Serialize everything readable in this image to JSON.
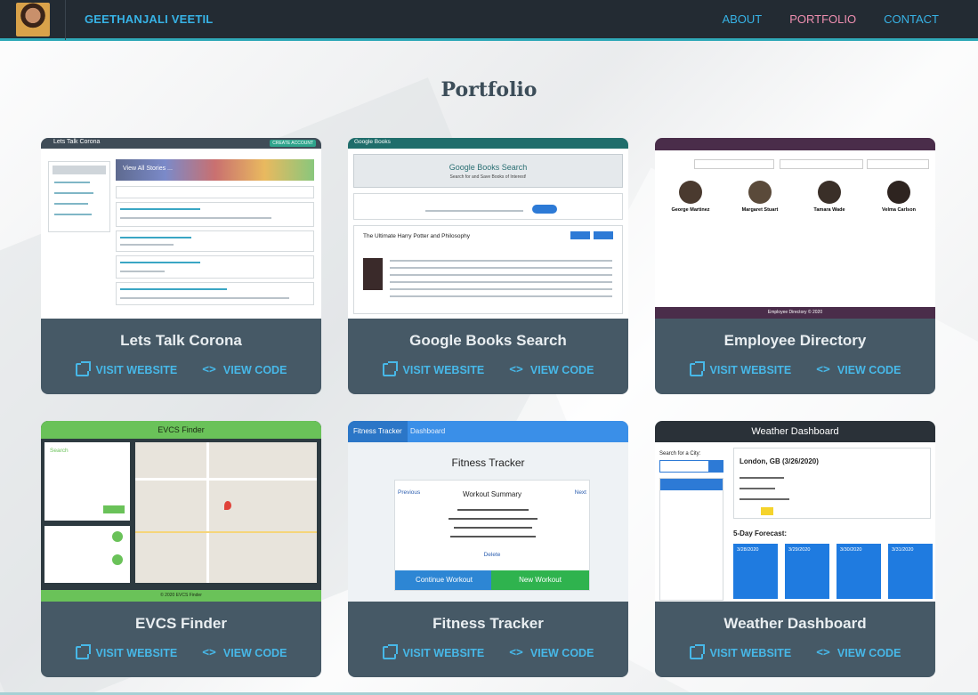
{
  "nav": {
    "brand": "GEETHANJALI VEETIL",
    "links": [
      {
        "label": "ABOUT",
        "active": false
      },
      {
        "label": "PORTFOLIO",
        "active": true
      },
      {
        "label": "CONTACT",
        "active": false
      }
    ]
  },
  "page": {
    "title": "Portfolio"
  },
  "cards": [
    {
      "title": "Lets Talk Corona",
      "visit_label": "VISIT WEBSITE",
      "code_label": "VIEW CODE",
      "thumb": {
        "header": "Lets Talk Corona",
        "banner": "View All Stories ...",
        "btn": "CREATE ACCOUNT"
      }
    },
    {
      "title": "Google Books Search",
      "visit_label": "VISIT WEBSITE",
      "code_label": "VIEW CODE",
      "thumb": {
        "header": "Google Books",
        "heading": "Google Books Search",
        "sub": "Search for and Save Books of Interest!",
        "book": "The Ultimate Harry Potter and Philosophy"
      }
    },
    {
      "title": "Employee Directory",
      "visit_label": "VISIT WEBSITE",
      "code_label": "VIEW CODE",
      "thumb": {
        "footer": "Employee Directory © 2020",
        "people": [
          "George Martinez",
          "Margaret Stuart",
          "Tamara Wade",
          "Velma Carlson"
        ]
      }
    },
    {
      "title": "EVCS Finder",
      "visit_label": "VISIT WEBSITE",
      "code_label": "VIEW CODE",
      "thumb": {
        "header": "EVCS Finder",
        "footer": "© 2020 EVCS Finder",
        "search": "Search"
      }
    },
    {
      "title": "Fitness Tracker",
      "visit_label": "VISIT WEBSITE",
      "code_label": "VIEW CODE",
      "thumb": {
        "tab1": "Fitness Tracker",
        "tab2": "Dashboard",
        "heading": "Fitness Tracker",
        "summary": "Workout Summary",
        "prev": "Previous",
        "next": "Next",
        "btn1": "Continue Workout",
        "btn2": "New Workout",
        "del": "Delete"
      }
    },
    {
      "title": "Weather Dashboard",
      "visit_label": "VISIT WEBSITE",
      "code_label": "VIEW CODE",
      "thumb": {
        "header": "Weather Dashboard",
        "city": "London, GB (3/26/2020)",
        "search": "Search for a City:",
        "forecast": "5-Day Forecast:",
        "days": [
          "3/28/2020",
          "3/29/2020",
          "3/30/2020",
          "3/31/2020"
        ]
      }
    }
  ],
  "colors": {
    "nav_bg": "#232b33",
    "accent": "#2fa9b8",
    "link": "#37b3e6",
    "active_link": "#ef8fb0",
    "card_bg": "#465966"
  }
}
